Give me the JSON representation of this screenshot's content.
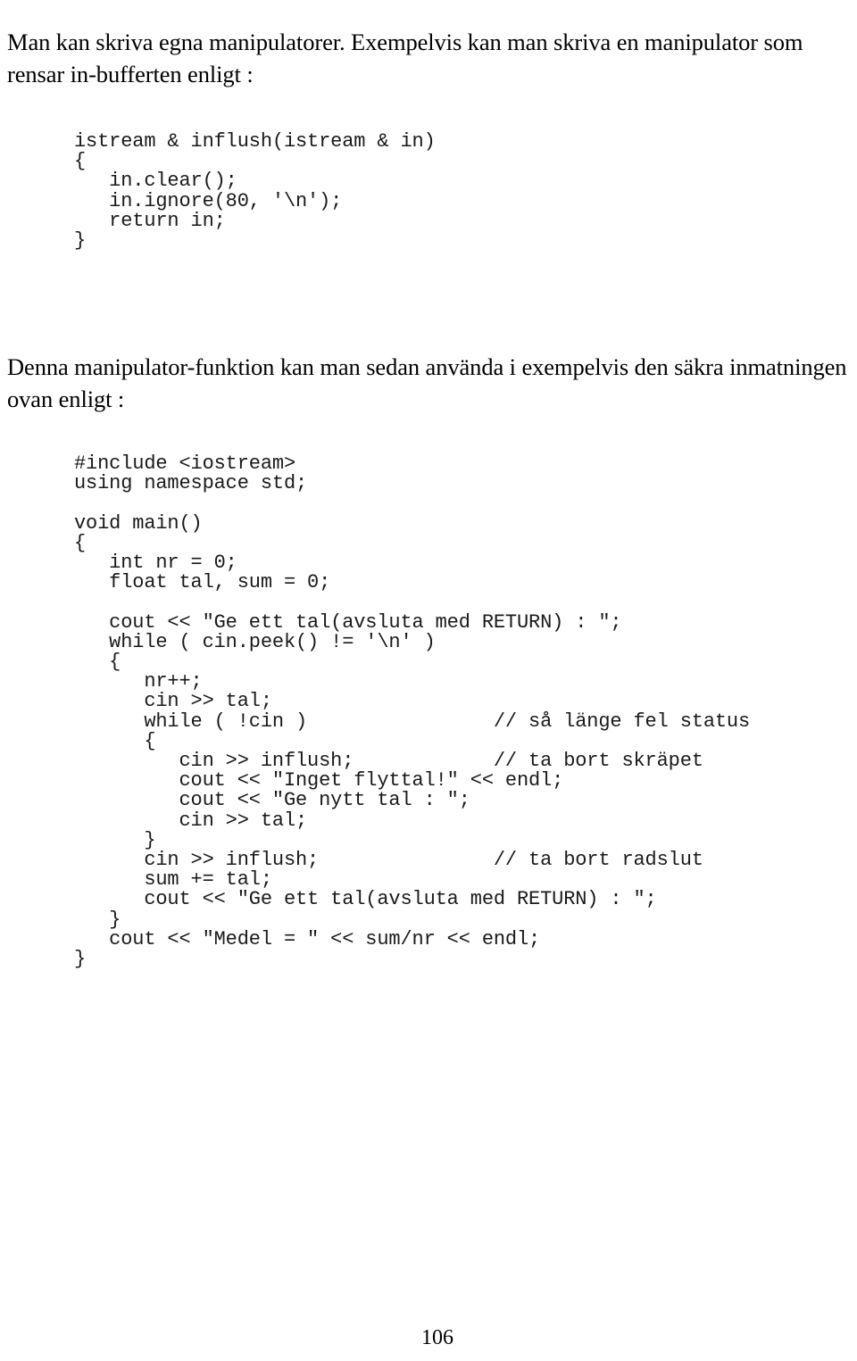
{
  "document": {
    "page_number": "106",
    "language": "sv",
    "paragraphs": {
      "intro": "Man kan skriva egna manipulatorer. Exempelvis kan man skriva en manipulator som rensar in-bufferten enligt :",
      "usage": "Denna manipulator-funktion kan man sedan använda i exempelvis den säkra inmatningen ovan enligt :"
    },
    "code_blocks": {
      "inflush": {
        "language": "cpp",
        "lines": [
          "istream & inflush(istream & in)",
          "{",
          "   in.clear();",
          "   in.ignore(80, '\\n');",
          "   return in;",
          "}"
        ]
      },
      "main": {
        "language": "cpp",
        "lines": [
          "#include <iostream>",
          "using namespace std;",
          "",
          "void main()",
          "{",
          "   int nr = 0;",
          "   float tal, sum = 0;",
          "",
          "   cout << \"Ge ett tal(avsluta med RETURN) : \";",
          "   while ( cin.peek() != '\\n' )",
          "   {",
          "      nr++;",
          "      cin >> tal;",
          "      while ( !cin )                // så länge fel status",
          "      {",
          "         cin >> inflush;            // ta bort skräpet",
          "         cout << \"Inget flyttal!\" << endl;",
          "         cout << \"Ge nytt tal : \";",
          "         cin >> tal;",
          "      }",
          "      cin >> inflush;               // ta bort radslut",
          "      sum += tal;",
          "      cout << \"Ge ett tal(avsluta med RETURN) : \";",
          "   }",
          "   cout << \"Medel = \" << sum/nr << endl;",
          "}"
        ]
      }
    }
  }
}
